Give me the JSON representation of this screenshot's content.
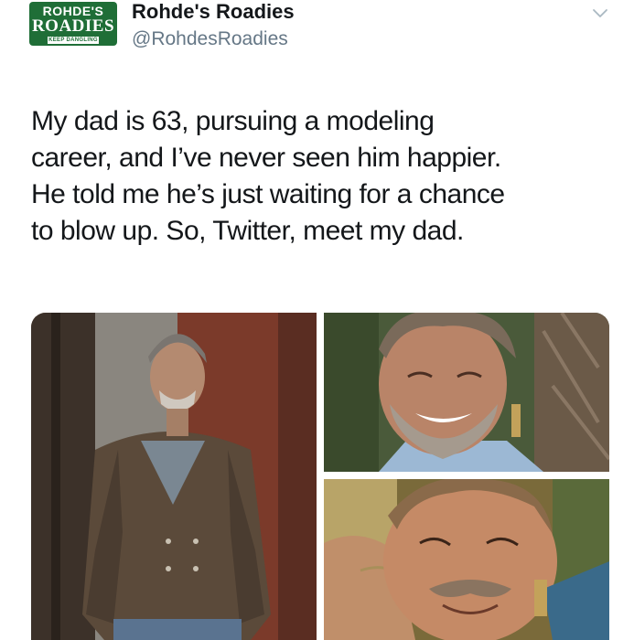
{
  "tweet": {
    "display_name": "Rohde's Roadies",
    "handle": "@RohdesRoadies",
    "avatar_logo": {
      "top": "ROHDE'S",
      "main": "ROADIES",
      "sub": "KEEP DANGLING"
    },
    "text_lines": [
      "My dad is 63, pursuing a modeling",
      "career, and I’ve never seen him happier.",
      "He told me he’s just waiting for a chance",
      "to blow up. So, Twitter, meet my dad."
    ]
  },
  "icons": {
    "menu": "chevron-down-icon"
  },
  "colors": {
    "brand_green": "#1f6e37",
    "text_primary": "#14171a",
    "text_secondary": "#657786"
  },
  "media": {
    "photos": [
      {
        "subject": "man in leather jacket standing by a door"
      },
      {
        "subject": "smiling man close-up outdoors"
      },
      {
        "subject": "man resting head on hand, mustache"
      }
    ]
  }
}
